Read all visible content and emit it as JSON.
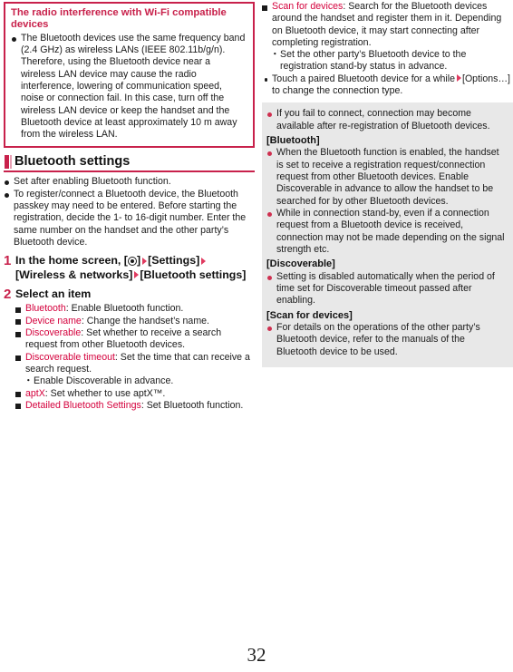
{
  "page": {
    "number": "32"
  },
  "left_column": {
    "note_box": {
      "title": "The radio interference with Wi-Fi compatible devices",
      "items": [
        "The Bluetooth devices use the same frequency band (2.4 GHz) as wireless LANs (IEEE 802.11b/g/n). Therefore, using the Bluetooth device near a wireless LAN device may cause the radio interference, lowering of communication speed, noise or connection fail. In this case, turn off the wireless LAN device or keep the handset and the Bluetooth device at least approximately 10 m away from the wireless LAN."
      ]
    },
    "section": {
      "heading": "Bluetooth settings",
      "intro_items": [
        "Set after enabling Bluetooth function.",
        "To register/connect a Bluetooth device, the Bluetooth passkey may need to be entered. Before starting the registration, decide the 1- to 16-digit number. Enter the same number on the handset and the other party’s Bluetooth device."
      ],
      "steps": [
        {
          "number": "1",
          "title_part1": "In the home screen, [",
          "title_icon": "home-key-icon",
          "title_part2": "]",
          "title_crumbs": [
            "[Settings]",
            "[Wireless & networks]",
            "[Bluetooth settings]"
          ]
        },
        {
          "number": "2",
          "title": "Select an item",
          "items": [
            {
              "term": "Bluetooth",
              "desc": ": Enable Bluetooth function."
            },
            {
              "term": "Device name",
              "desc": ": Change the handset’s name."
            },
            {
              "term": "Discoverable",
              "desc": ": Set whether to receive a search request from other Bluetooth devices."
            },
            {
              "term": "Discoverable timeout",
              "desc": ": Set the time that can receive a search request.",
              "sub": [
                "Enable Discoverable in advance."
              ]
            },
            {
              "term": "aptX",
              "desc": ": Set whether to use aptX™."
            },
            {
              "term": "Detailed Bluetooth Settings",
              "desc": ": Set Bluetooth function."
            }
          ]
        }
      ]
    }
  },
  "right_column": {
    "continued_items": [
      {
        "term": "Scan for devices",
        "desc": ": Search for the Bluetooth devices around the handset and register them in it. Depending on Bluetooth device, it may start connecting after completing registration.",
        "sub": [
          "Set the other party’s Bluetooth device to the registration stand-by status in advance."
        ]
      }
    ],
    "note_after": "Touch a paired Bluetooth device for a while",
    "note_after_2": "[Options…] to change the connection type.",
    "gray_panel": {
      "lead_items": [
        "If you fail to connect, connection may become available after re-registration of Bluetooth devices."
      ],
      "groups": [
        {
          "heading": "[Bluetooth]",
          "items": [
            "When the Bluetooth function is enabled, the handset is set to receive a registration request/connection request from other Bluetooth devices. Enable Discoverable in advance to allow the handset to be searched for by other Bluetooth devices.",
            "While in connection stand-by, even if a connection request from a Bluetooth device is received, connection may not be made depending on the signal strength etc."
          ]
        },
        {
          "heading": "[Discoverable]",
          "items": [
            "Setting is disabled automatically when the period of time set for Discoverable timeout passed after enabling."
          ]
        },
        {
          "heading": "[Scan for devices]",
          "items": [
            "For details on the operations of the other party’s Bluetooth device, refer to the manuals of the Bluetooth device to be used."
          ]
        }
      ]
    }
  }
}
